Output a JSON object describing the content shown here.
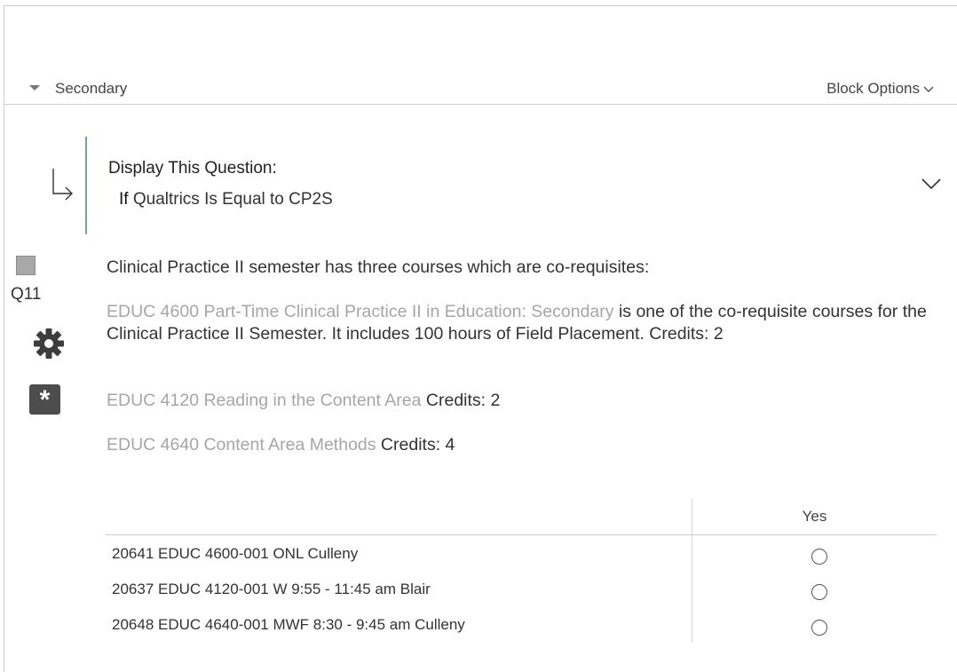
{
  "block": {
    "title": "Secondary",
    "options_label": "Block Options"
  },
  "display_logic": {
    "title": "Display This Question:",
    "if_word": "If",
    "condition": "Qualtrics Is Equal to CP2S"
  },
  "question": {
    "number": "Q11",
    "required_symbol": "*",
    "intro": "Clinical Practice II semester has three courses which are co-requisites:",
    "course1_name": "EDUC 4600 Part-Time Clinical Practice II in Education: Secondary",
    "course1_desc": " is one of the co-requisite courses for the Clinical Practice II Semester.  It includes 100 hours of Field Placement.  Credits: 2",
    "course2_name": "EDUC 4120 Reading in the Content Area",
    "course2_credits": " Credits: 2",
    "course3_name": "EDUC 4640 Content Area Methods",
    "course3_credits": " Credits: 4"
  },
  "matrix": {
    "column": "Yes",
    "rows": [
      "20641 EDUC 4600-001 ONL Culleny",
      "20637 EDUC 4120-001 W 9:55 - 11:45 am Blair",
      "20648 EDUC 4640-001 MWF 8:30 - 9:45 am Culleny"
    ]
  },
  "colors": {
    "logic_bar": "#7a9db3",
    "muted_text": "#a6a6a6",
    "badge": "#4d4d4d"
  },
  "icons": [
    "caret-down-icon",
    "chevron-down-icon",
    "logic-arrow-icon",
    "gear-icon",
    "asterisk-icon"
  ]
}
